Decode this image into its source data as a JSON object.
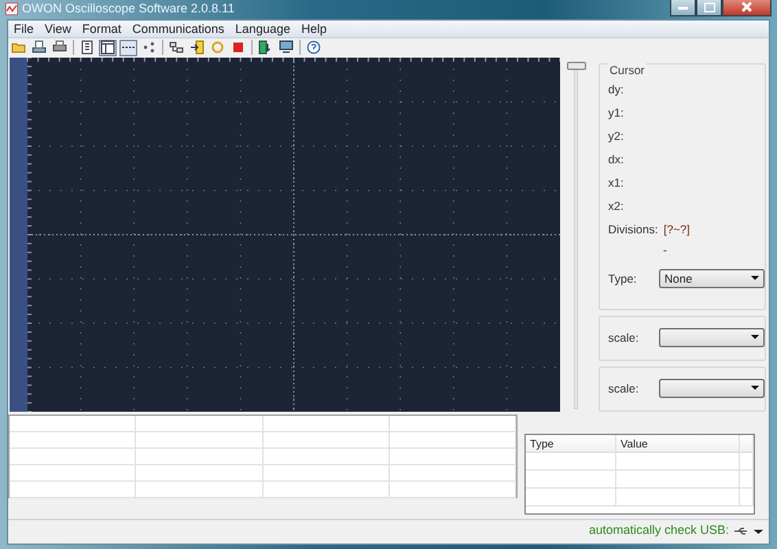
{
  "window": {
    "title": "OWON Oscilloscope Software 2.0.8.11"
  },
  "menu": [
    "File",
    "View",
    "Format",
    "Communications",
    "Language",
    "Help"
  ],
  "toolbar": [
    {
      "kind": "open",
      "pressed": false
    },
    {
      "kind": "save",
      "pressed": false
    },
    {
      "kind": "print",
      "pressed": false
    },
    {
      "kind": "sep"
    },
    {
      "kind": "list",
      "pressed": false
    },
    {
      "kind": "window",
      "pressed": true
    },
    {
      "kind": "dots",
      "pressed": true
    },
    {
      "kind": "share",
      "pressed": false
    },
    {
      "kind": "sep"
    },
    {
      "kind": "network",
      "pressed": false
    },
    {
      "kind": "import",
      "pressed": false
    },
    {
      "kind": "refresh",
      "pressed": false
    },
    {
      "kind": "stop",
      "pressed": false
    },
    {
      "kind": "sep"
    },
    {
      "kind": "download",
      "pressed": false
    },
    {
      "kind": "monitor",
      "pressed": false
    },
    {
      "kind": "sep"
    },
    {
      "kind": "help",
      "pressed": false
    }
  ],
  "cursor_panel": {
    "title": "Cursor",
    "fields": [
      {
        "label": "dy:"
      },
      {
        "label": "y1:"
      },
      {
        "label": "y2:"
      },
      {
        "label": "dx:"
      },
      {
        "label": "x1:"
      },
      {
        "label": "x2:"
      }
    ],
    "divisions": {
      "label": "Divisions:",
      "value": "[?~?]"
    },
    "dash": "-",
    "type": {
      "label": "Type:",
      "value": "None"
    }
  },
  "scale_fields": [
    {
      "label": "scale:"
    },
    {
      "label": "scale:"
    }
  ],
  "data_table": {
    "columns": [
      "Type",
      "Value"
    ]
  },
  "status_bar": {
    "text": "automatically check USB:"
  }
}
